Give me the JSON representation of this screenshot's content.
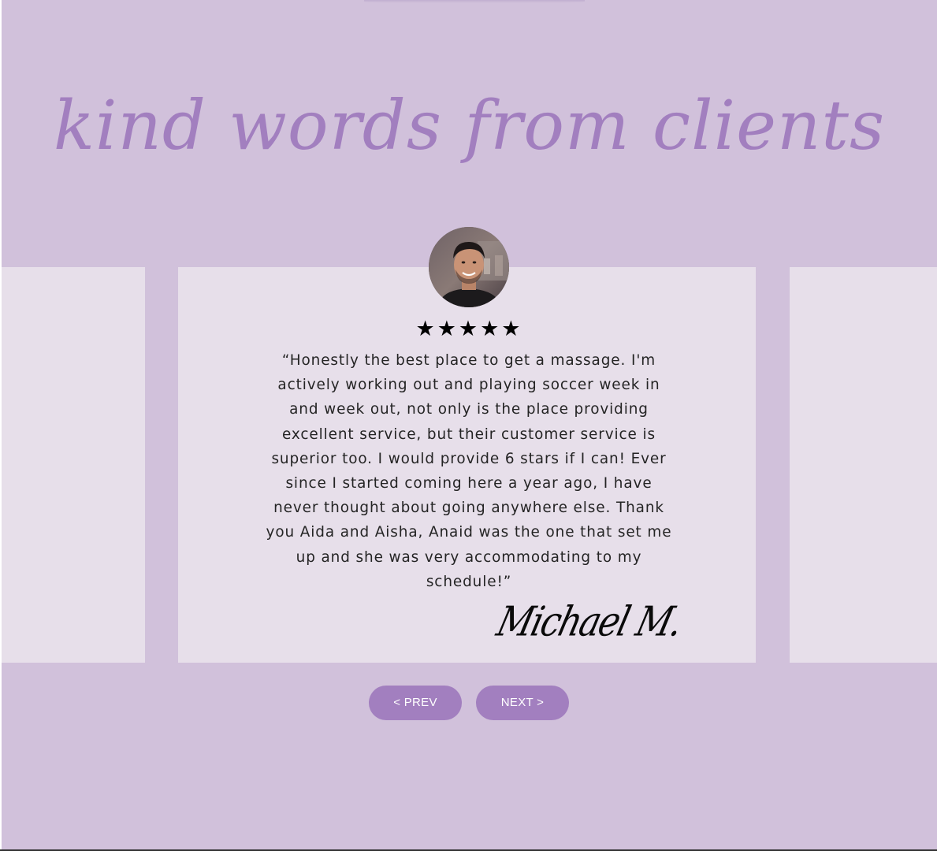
{
  "section": {
    "heading": "kind words from clients"
  },
  "testimonial": {
    "rating_stars": "★★★★★",
    "rating": 5,
    "quote": "“Honestly the best place to get a massage. I'm actively working out and playing soccer week in and week out, not only is the place providing excellent service, but their customer service is superior too. I would provide 6 stars if I can! Ever since I started coming here a year ago, I have never thought about going anywhere else. Thank you Aida and Aisha, Anaid was the one that set me up and she was very accommodating to my schedule!”",
    "author_signature": "Michael M."
  },
  "navigation": {
    "prev_label": "< PREV",
    "next_label": "NEXT >"
  },
  "colors": {
    "background": "#d1c1db",
    "card": "#e7dfea",
    "accent": "#a27fbf",
    "text": "#242424"
  }
}
